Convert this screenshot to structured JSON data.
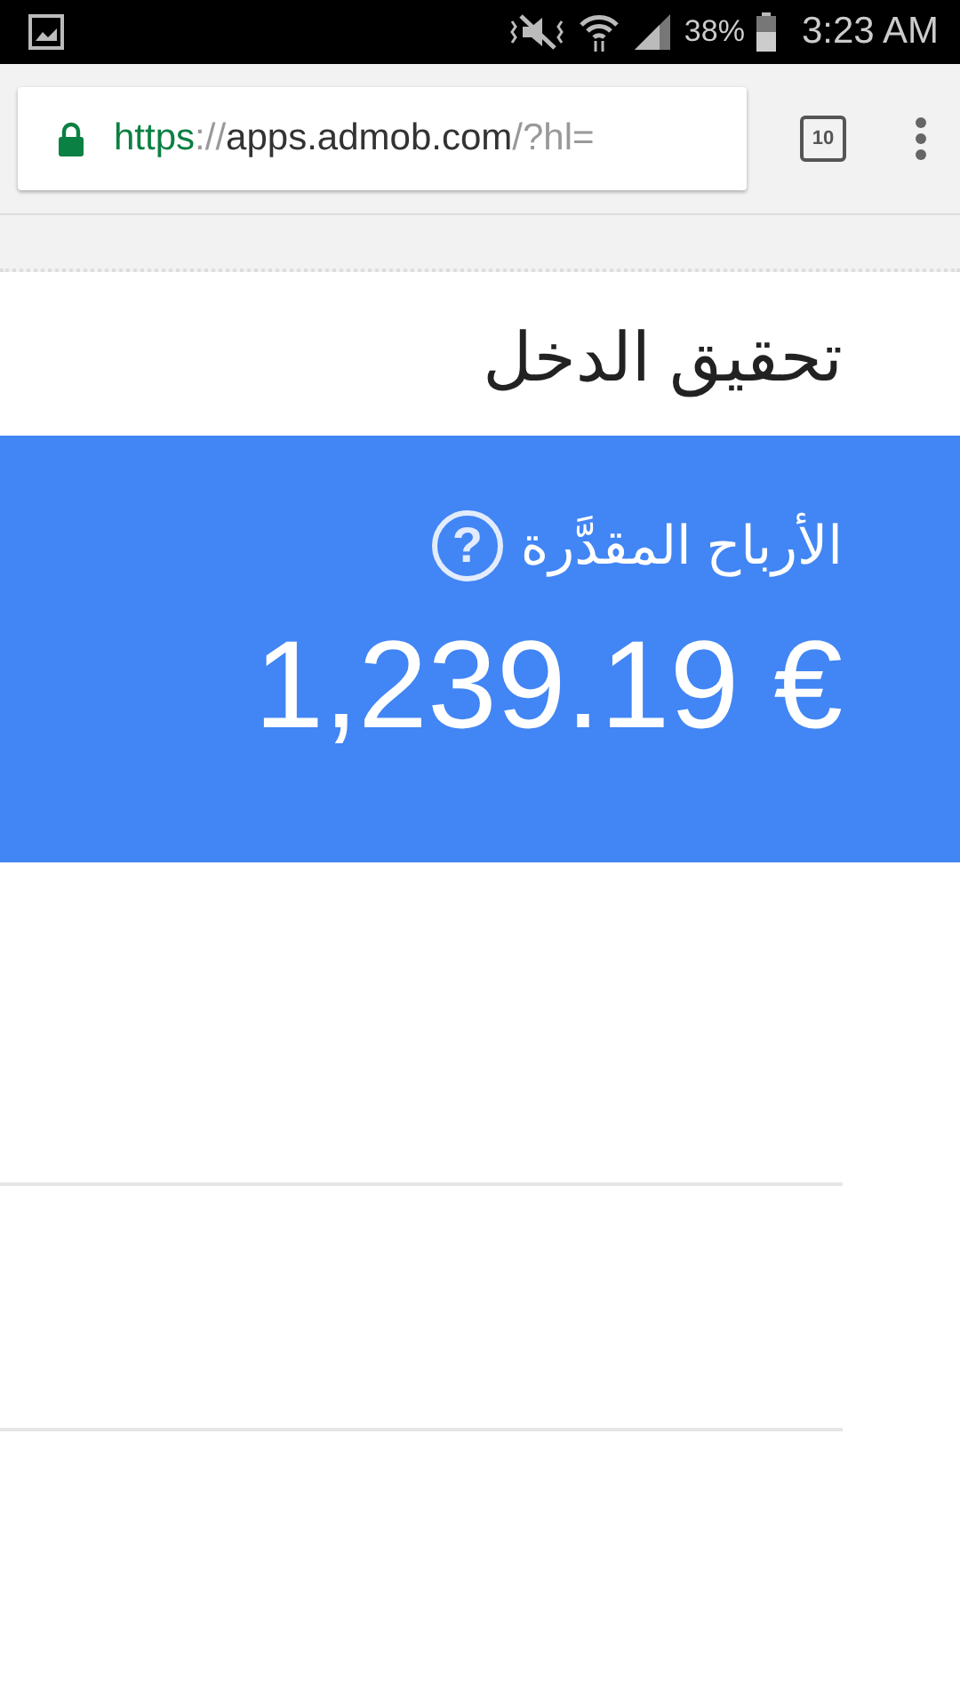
{
  "status_bar": {
    "battery": "38%",
    "time": "3:23 AM"
  },
  "browser": {
    "url_parts": [
      {
        "kind": "scheme",
        "text": "https"
      },
      {
        "kind": "muted",
        "text": "://"
      },
      {
        "kind": "host",
        "text": "apps.admob.com"
      },
      {
        "kind": "muted",
        "text": "/?hl="
      }
    ],
    "tab_count": "10"
  },
  "page": {
    "title": "تحقيق الدخل",
    "earnings": {
      "label": "الأرباح المقدَّرة",
      "help": "?",
      "value": "1,239.19 €"
    }
  }
}
